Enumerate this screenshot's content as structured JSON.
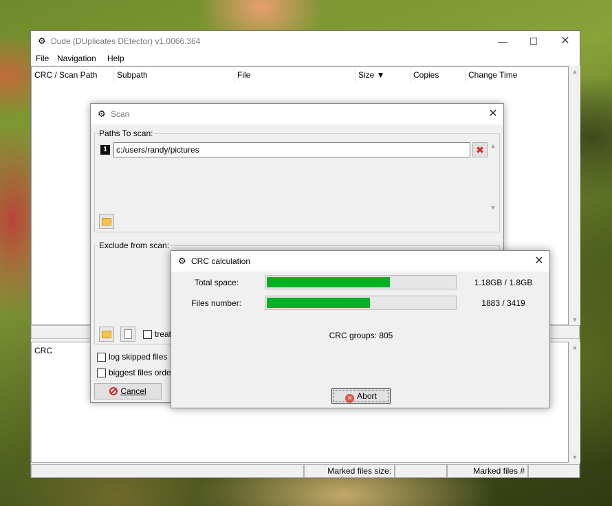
{
  "main": {
    "title": "Dude (DUplicates DEtector) v1.0066.364",
    "menu": [
      "File",
      "Navigation",
      "Help"
    ],
    "columns": [
      "CRC / Scan Path",
      "Subpath",
      "File",
      "Size ▼",
      "Copies",
      "Change Time"
    ],
    "lower_header": "CRC",
    "status": {
      "marked_size_label": "Marked files size:",
      "marked_count_label": "Marked files #"
    }
  },
  "scan": {
    "title": "Scan",
    "paths_label": "Paths To scan:",
    "path_number": "1",
    "path_value": "c:/users/randy/pictures",
    "exclude_label": "Exclude from scan:",
    "treat_label": "treat",
    "log_skipped_label": "log skipped files",
    "biggest_label": "biggest files orde",
    "cancel_label": "Cancel"
  },
  "crc": {
    "title": "CRC calculation",
    "rows": [
      {
        "label": "Total space:",
        "value": "1.18GB / 1.8GB",
        "progress": 0.656
      },
      {
        "label": "Files number:",
        "value": "1883 / 3419",
        "progress": 0.551
      }
    ],
    "groups_text": "CRC groups: 805",
    "abort_label": "Abort"
  },
  "colors": {
    "progress": "#06b025",
    "delete": "#d8261c"
  }
}
